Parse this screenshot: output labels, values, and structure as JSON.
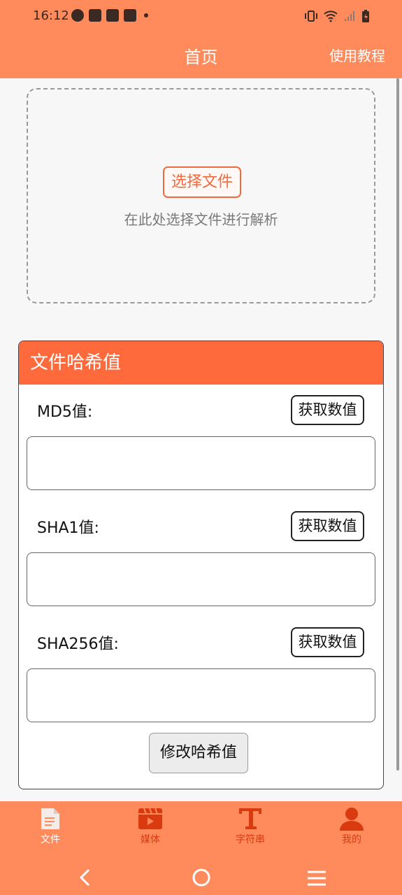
{
  "status": {
    "time": "16:12"
  },
  "header": {
    "title": "首页",
    "help": "使用教程"
  },
  "drop": {
    "button": "选择文件",
    "hint": "在此处选择文件进行解析"
  },
  "hash": {
    "title": "文件哈希值",
    "rows": [
      {
        "label": "MD5值:",
        "button": "获取数值",
        "value": ""
      },
      {
        "label": "SHA1值:",
        "button": "获取数值",
        "value": ""
      },
      {
        "label": "SHA256值:",
        "button": "获取数值",
        "value": ""
      }
    ],
    "modify": "修改哈希值"
  },
  "nav": {
    "items": [
      {
        "label": "文件",
        "icon": "file-icon",
        "active": true
      },
      {
        "label": "媒体",
        "icon": "video-icon",
        "active": false
      },
      {
        "label": "字符串",
        "icon": "text-icon",
        "active": false
      },
      {
        "label": "我的",
        "icon": "user-icon",
        "active": false
      }
    ]
  },
  "colors": {
    "accent": "#ff8a5c",
    "header": "#ff6a3d",
    "nav_active": "#ffffff",
    "nav_inactive": "#d93a10"
  }
}
